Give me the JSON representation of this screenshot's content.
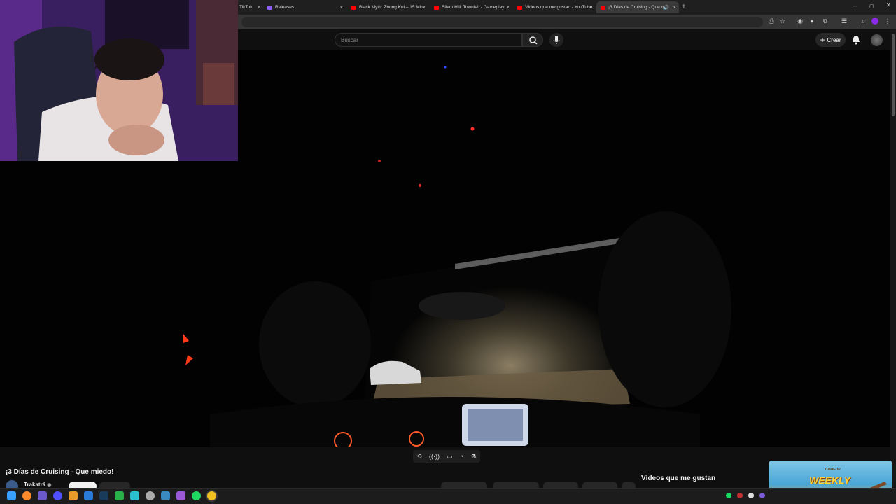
{
  "browser": {
    "tabs": [
      {
        "title": "TikTok",
        "fav": "#ffffff"
      },
      {
        "title": "Releases",
        "fav": "#8b5cf6"
      },
      {
        "title": "Black Myth: Zhong Kui – 15 Min",
        "fav": "#ff0000"
      },
      {
        "title": "Silent Hill: Townfall - Gameplay",
        "fav": "#ff0000"
      },
      {
        "title": "Vídeos que me gustan - YouTube",
        "fav": "#ff0000"
      },
      {
        "title": "¡3 Días de Cruising - Que m",
        "fav": "#ff0000"
      }
    ],
    "new_tab": "+",
    "window_controls": {
      "minimize": "–",
      "maximize": "▢",
      "close": "✕"
    }
  },
  "youtube": {
    "search_placeholder": "Buscar",
    "create_label": "Crear",
    "video_title": "¡3 Días de Cruising - Que miedo!",
    "channel_name": "Trakatrá",
    "playlist_title": "Vídeos que me gustan"
  },
  "ad": {
    "brand": "CODEOP",
    "headline": "WEEKLY"
  },
  "colors": {
    "accent": "#ff0000",
    "page_bg": "#0f0f0f",
    "ad_text": "#ffd23a"
  }
}
